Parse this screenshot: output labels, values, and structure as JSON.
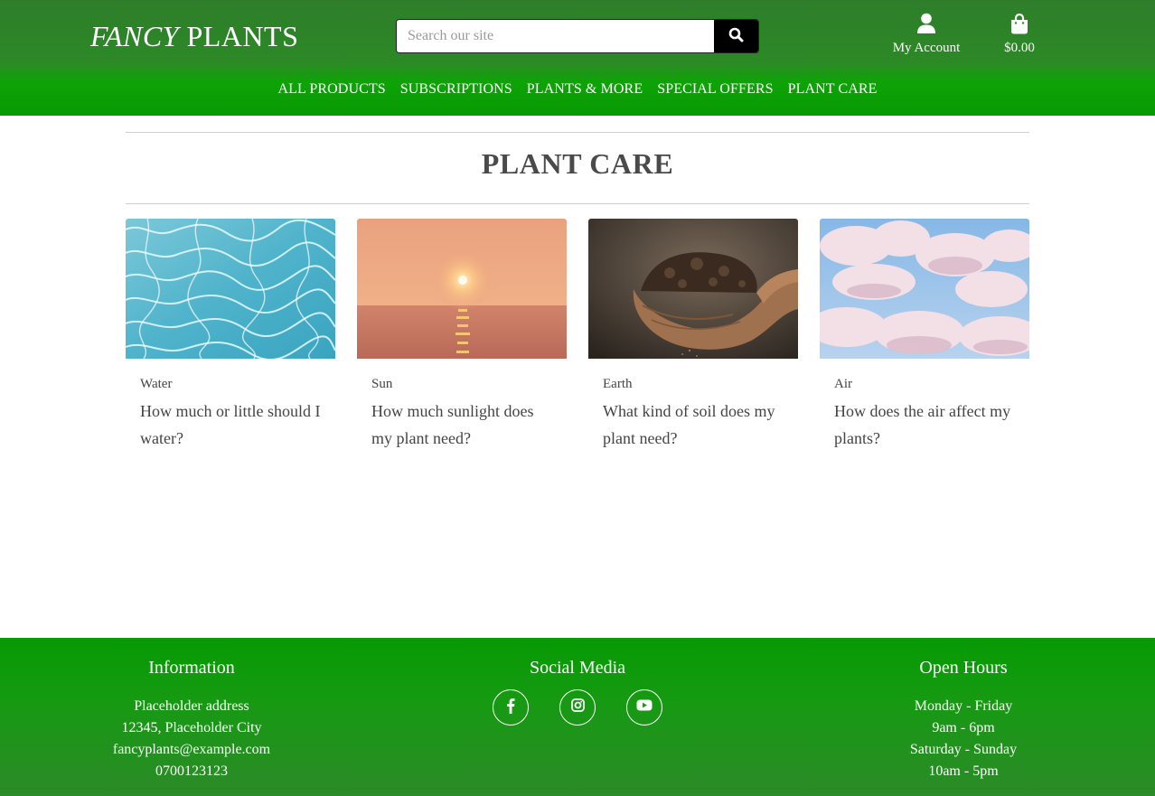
{
  "brand": {
    "logo_italic": "FANCY",
    "logo_rest": " PLANTS"
  },
  "search": {
    "placeholder": "Search our site",
    "value": ""
  },
  "header": {
    "account_label": "My Account",
    "bag_total": "$0.00"
  },
  "nav": {
    "items": [
      {
        "label": "ALL PRODUCTS"
      },
      {
        "label": "SUBSCRIPTIONS"
      },
      {
        "label": "PLANTS & MORE"
      },
      {
        "label": "SPECIAL OFFERS"
      },
      {
        "label": "PLANT CARE"
      }
    ]
  },
  "main": {
    "title": "PLANT CARE",
    "cards": [
      {
        "category": "Water",
        "question": "How much or little should I water?",
        "image": "water-ripples-photo"
      },
      {
        "category": "Sun",
        "question": "How much sunlight does my plant need?",
        "image": "sunset-over-sea-photo"
      },
      {
        "category": "Earth",
        "question": "What kind of soil does my plant need?",
        "image": "hands-holding-soil-photo"
      },
      {
        "category": "Air",
        "question": "How does the air affect my plants?",
        "image": "clouds-in-sky-photo"
      }
    ]
  },
  "footer": {
    "info": {
      "heading": "Information",
      "lines": [
        "Placeholder address",
        "12345, Placeholder City",
        "fancyplants@example.com",
        "0700123123"
      ]
    },
    "social": {
      "heading": "Social Media",
      "icons": [
        "facebook-icon",
        "instagram-icon",
        "youtube-icon"
      ]
    },
    "hours": {
      "heading": "Open Hours",
      "lines": [
        "Monday - Friday",
        "9am - 6pm",
        "Saturday - Sunday",
        "10am - 5pm"
      ]
    }
  },
  "colors": {
    "header_green": "#2c8a26",
    "nav_green": "#089a04",
    "footer_green": "#069a03",
    "search_button": "#000000",
    "text": "#444444"
  }
}
